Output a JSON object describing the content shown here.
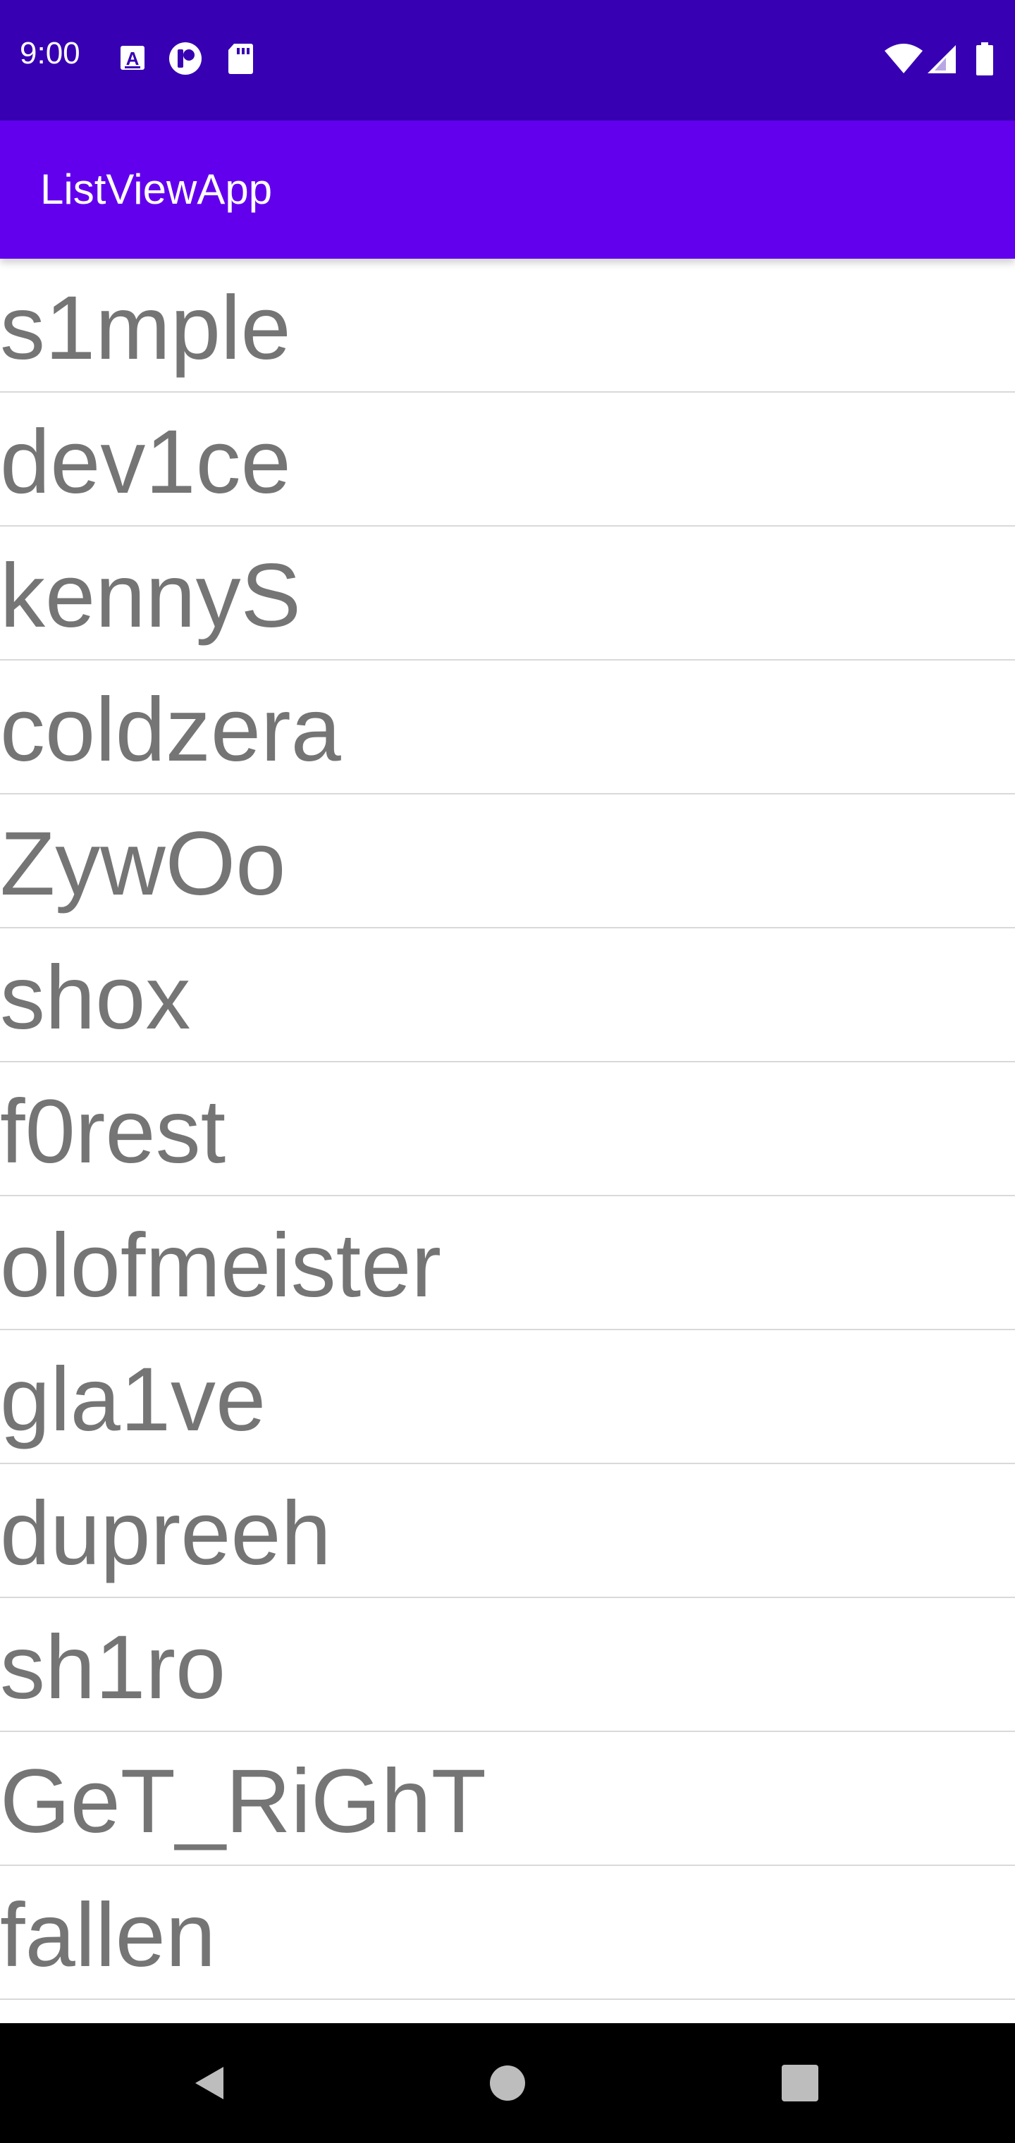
{
  "status_bar": {
    "time": "9:00",
    "left_icons": [
      "font-a-icon",
      "media-icon",
      "sd-card-icon"
    ],
    "right_icons": [
      "wifi-icon",
      "cell-signal-icon",
      "battery-icon"
    ]
  },
  "app_bar": {
    "title": "ListViewApp"
  },
  "list": {
    "items": [
      "s1mple",
      "dev1ce",
      "kennyS",
      "coldzera",
      "ZywOo",
      "shox",
      "f0rest",
      "olofmeister",
      "gla1ve",
      "dupreeh",
      "sh1ro",
      "GeT_RiGhT",
      "fallen"
    ]
  },
  "nav_bar": {
    "buttons": [
      "back-icon",
      "home-icon",
      "recents-icon"
    ]
  },
  "colors": {
    "status_bar": "#3700b3",
    "app_bar": "#6200ee",
    "list_text": "#757575",
    "divider": "#d9d9d9",
    "nav_bar": "#000000"
  }
}
